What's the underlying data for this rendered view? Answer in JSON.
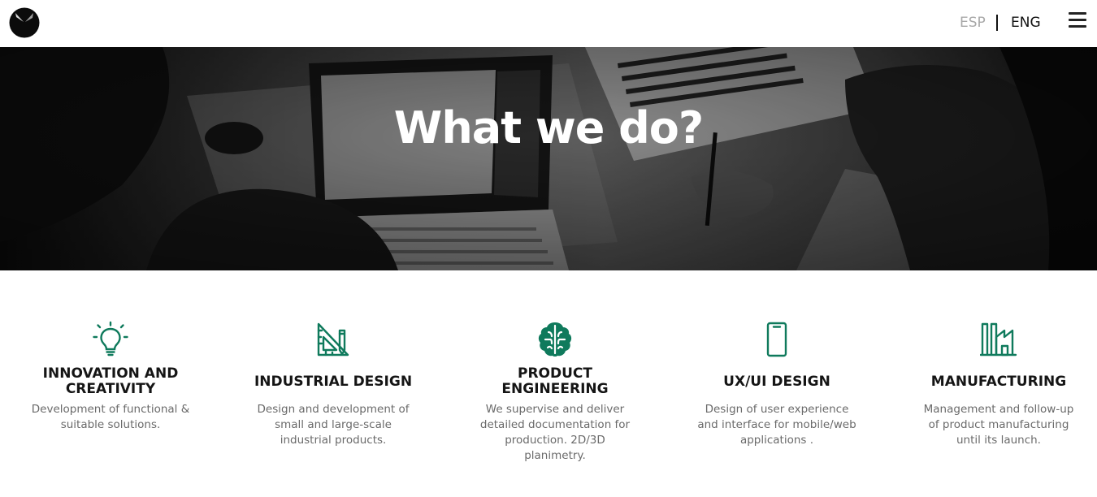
{
  "header": {
    "languages": {
      "esp": "ESP",
      "eng": "ENG",
      "active": "ENG"
    },
    "logo_icon": "circle-logo-icon",
    "menu_icon": "hamburger-icon"
  },
  "hero": {
    "title": "What we do?",
    "background": "grayscale photo of people working at laptops"
  },
  "services": [
    {
      "icon": "lightbulb-icon",
      "title": "INNOVATION AND CREATIVITY",
      "description": "Development of functional & suitable solutions."
    },
    {
      "icon": "ruler-pencil-icon",
      "title": "INDUSTRIAL DESIGN",
      "description": "Design and development of small and large-scale industrial products."
    },
    {
      "icon": "brain-icon",
      "title": "PRODUCT ENGINEERING",
      "description": "We supervise and deliver detailed documentation for production. 2D/3D planimetry."
    },
    {
      "icon": "smartphone-icon",
      "title": "UX/UI DESIGN",
      "description": "Design of user experience and interface for mobile/web applications ."
    },
    {
      "icon": "factory-icon",
      "title": "MANUFACTURING",
      "description": "Management and follow-up of product manufacturing until its launch."
    }
  ],
  "colors": {
    "accent": "#0f7a5c",
    "title": "#151515",
    "text": "#6a6a6a"
  }
}
